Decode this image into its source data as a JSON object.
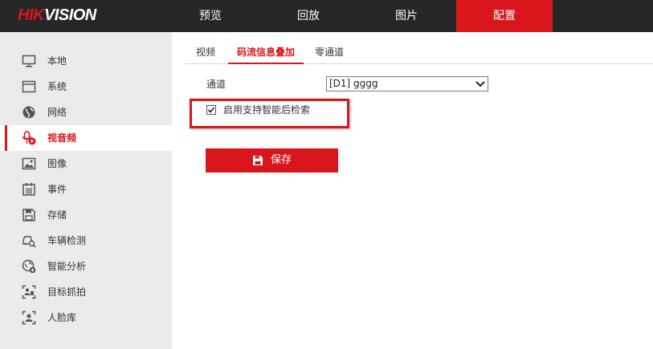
{
  "brand": {
    "logo_main": "HIKVISION",
    "accent": "#d9161c"
  },
  "nav": {
    "tabs": [
      {
        "label": "预览",
        "active": false
      },
      {
        "label": "回放",
        "active": false
      },
      {
        "label": "图片",
        "active": false
      },
      {
        "label": "配置",
        "active": true
      }
    ]
  },
  "sidebar": {
    "items": [
      {
        "label": "本地",
        "icon": "monitor-icon"
      },
      {
        "label": "系统",
        "icon": "window-icon"
      },
      {
        "label": "网络",
        "icon": "globe-icon"
      },
      {
        "label": "视音频",
        "icon": "mic-video-icon",
        "active": true
      },
      {
        "label": "图像",
        "icon": "image-icon"
      },
      {
        "label": "事件",
        "icon": "calendar-icon"
      },
      {
        "label": "存储",
        "icon": "save-disk-icon"
      },
      {
        "label": "车辆检测",
        "icon": "vehicle-search-icon"
      },
      {
        "label": "智能分析",
        "icon": "smart-analysis-icon"
      },
      {
        "label": "目标抓拍",
        "icon": "target-capture-icon"
      },
      {
        "label": "人脸库",
        "icon": "face-library-icon"
      }
    ]
  },
  "subtabs": [
    {
      "label": "视频",
      "active": false
    },
    {
      "label": "码流信息叠加",
      "active": true
    },
    {
      "label": "零通道",
      "active": false
    }
  ],
  "form": {
    "channel_label": "通道",
    "channel_value": "[D1] gggg",
    "checkbox_label": "启用支持智能后检索",
    "checkbox_checked": true,
    "save_label": "保存"
  }
}
